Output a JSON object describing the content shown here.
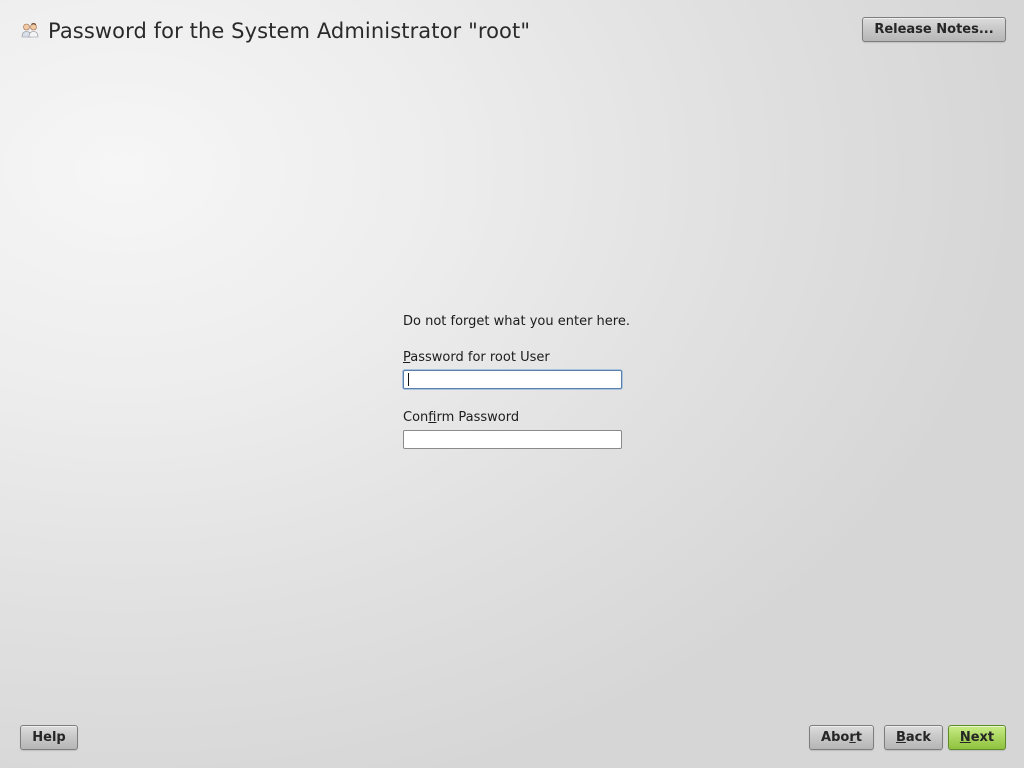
{
  "header": {
    "title": "Password for the System Administrator \"root\"",
    "title_icon": "admin-users-icon",
    "release_notes_label": "Release Notes..."
  },
  "form": {
    "hint": "Do not forget what you enter here.",
    "password_label": {
      "mnemonic": "P",
      "rest": "assword for root User"
    },
    "password_value": "",
    "confirm_label": {
      "before": "Con",
      "mnemonic": "f",
      "rest": "irm Password"
    },
    "confirm_value": ""
  },
  "footer": {
    "help_label": "Help",
    "abort": {
      "before": "Abo",
      "mnemonic": "r",
      "rest": "t"
    },
    "back": {
      "mnemonic": "B",
      "rest": "ack"
    },
    "next": {
      "mnemonic": "N",
      "rest": "ext"
    }
  },
  "colors": {
    "next_button": "#a7d45c",
    "button": "#c7c7c7",
    "focus_border": "#5a7fa8"
  }
}
